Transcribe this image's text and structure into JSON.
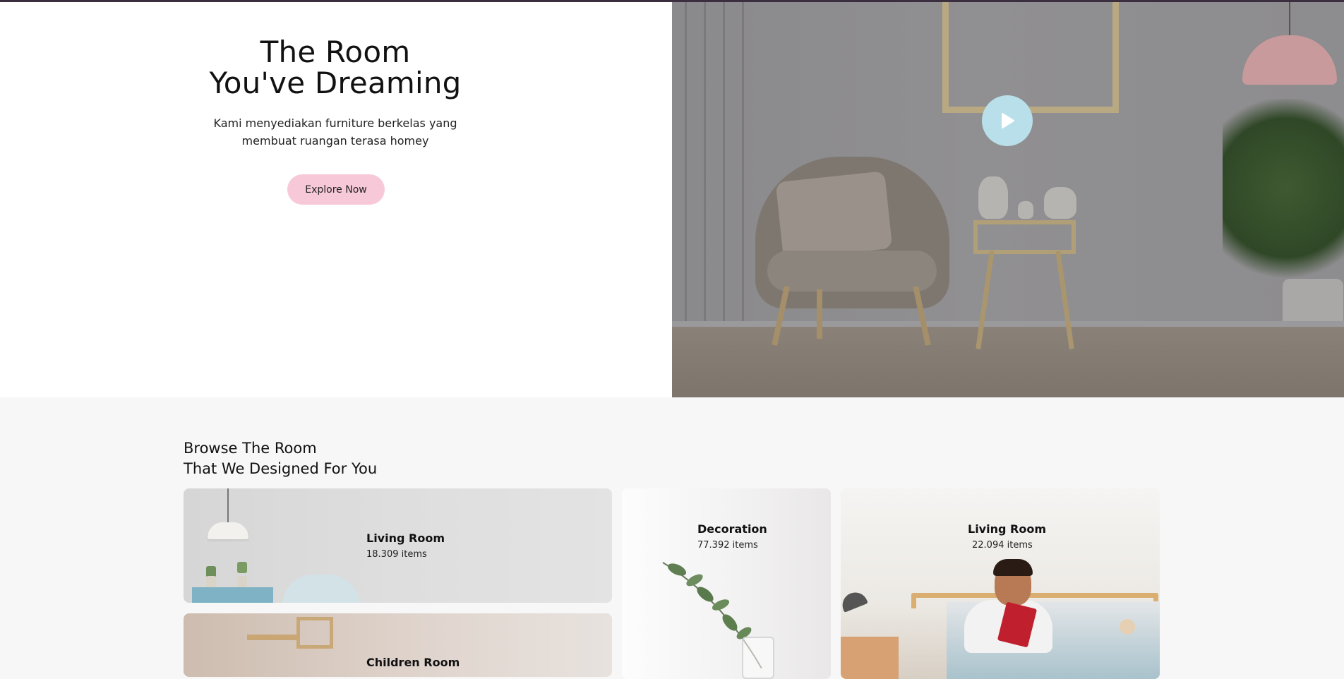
{
  "hero": {
    "title_line1": "The Room",
    "title_line2": "You've Dreaming",
    "subtitle": "Kami menyediakan furniture berkelas yang membuat ruangan terasa homey",
    "cta_label": "Explore Now"
  },
  "browse": {
    "title_line1": "Browse The Room",
    "title_line2": "That We Designed For You",
    "cards": [
      {
        "title": "Living Room",
        "count": "18.309 items"
      },
      {
        "title": "Decoration",
        "count": "77.392 items"
      },
      {
        "title": "Living Room",
        "count": "22.094 items"
      },
      {
        "title": "Children Room",
        "count": ""
      }
    ]
  },
  "colors": {
    "cta_background": "#f7c8d8",
    "play_button": "#b9e0ea",
    "section_background": "#f7f7f7"
  },
  "icons": {
    "play": "play-icon"
  }
}
